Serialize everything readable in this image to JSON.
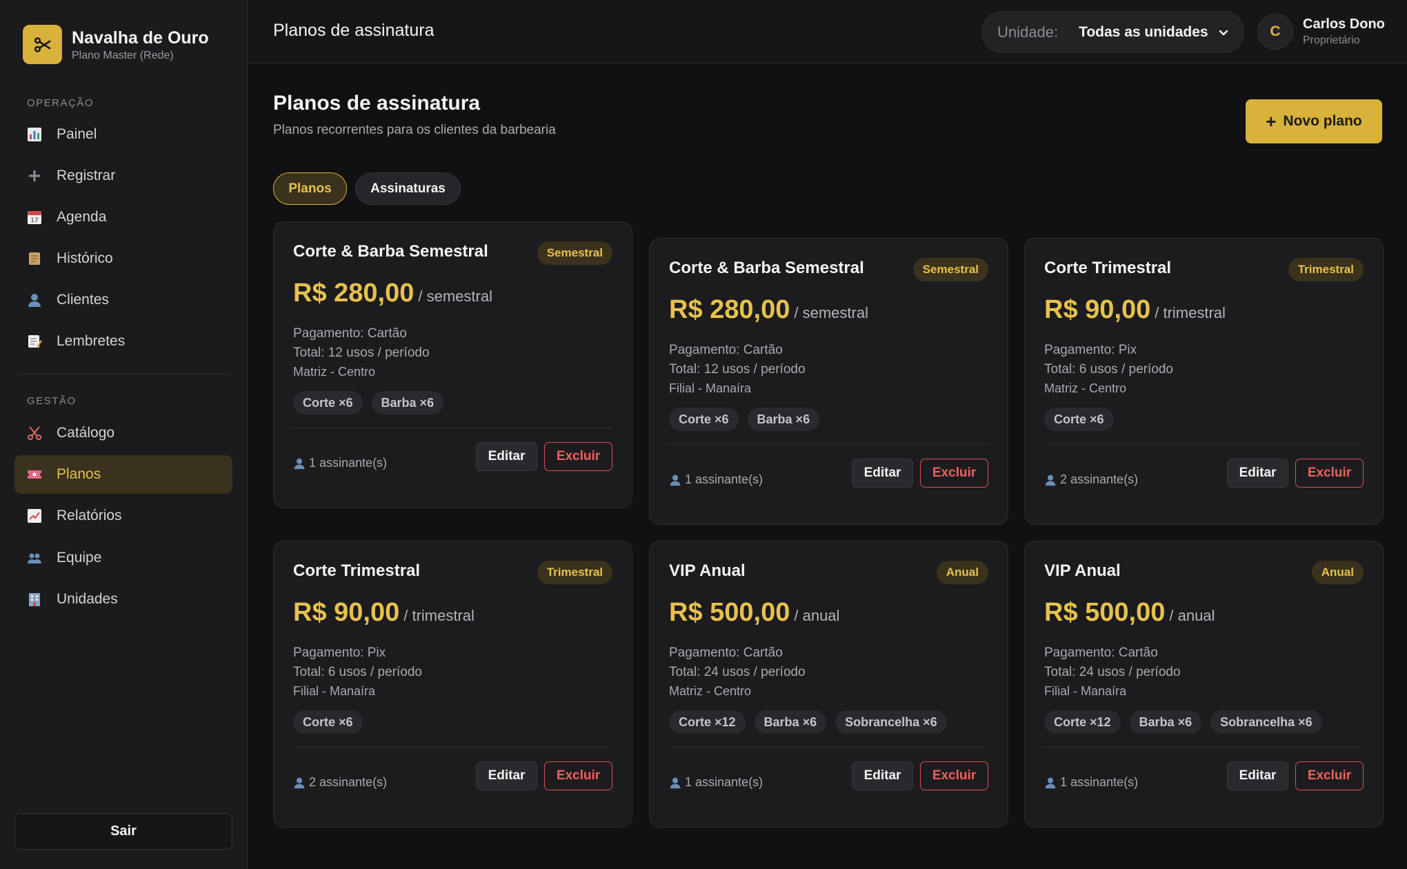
{
  "brand": {
    "name": "Navalha de Ouro",
    "plan": "Plano Master (Rede)"
  },
  "sidebar": {
    "section_operacao": "OPERAÇÃO",
    "section_gestao": "GESTÃO",
    "items": [
      {
        "label": "Painel",
        "icon": "chart-icon"
      },
      {
        "label": "Registrar",
        "icon": "plus-icon"
      },
      {
        "label": "Agenda",
        "icon": "calendar-icon"
      },
      {
        "label": "Histórico",
        "icon": "scroll-icon"
      },
      {
        "label": "Clientes",
        "icon": "user-icon"
      },
      {
        "label": "Lembretes",
        "icon": "memo-icon"
      },
      {
        "label": "Catálogo",
        "icon": "scissors-icon"
      },
      {
        "label": "Planos",
        "icon": "ticket-icon"
      },
      {
        "label": "Relatórios",
        "icon": "trend-icon"
      },
      {
        "label": "Equipe",
        "icon": "users-icon"
      },
      {
        "label": "Unidades",
        "icon": "building-icon"
      }
    ],
    "active": "Planos",
    "logout_label": "Sair"
  },
  "topbar": {
    "title": "Planos de assinatura",
    "unit_label": "Unidade:",
    "unit_value": "Todas as unidades",
    "user_initial": "C",
    "user_name": "Carlos Dono",
    "user_role": "Proprietário"
  },
  "main": {
    "title": "Planos de assinatura",
    "subtitle": "Planos recorrentes para os clientes da barbearia",
    "new_plan_label": "Novo plano",
    "tabs": [
      {
        "label": "Planos"
      },
      {
        "label": "Assinaturas"
      }
    ],
    "edit_label": "Editar",
    "delete_label": "Excluir"
  },
  "plans": [
    {
      "name": "Corte & Barba Semestral",
      "badge": "Semestral",
      "price": "R$ 280,00",
      "period": "/ semestral",
      "payment": "Pagamento: Cartão",
      "total": "Total: 12 usos / período",
      "unit": "Matriz - Centro",
      "services": [
        "Corte ×6",
        "Barba ×6"
      ],
      "subscribers": "1 assinante(s)"
    },
    {
      "name": "Corte & Barba Semestral",
      "badge": "Semestral",
      "price": "R$ 280,00",
      "period": "/ semestral",
      "payment": "Pagamento: Cartão",
      "total": "Total: 12 usos / período",
      "unit": "Filial - Manaíra",
      "services": [
        "Corte ×6",
        "Barba ×6"
      ],
      "subscribers": "1 assinante(s)"
    },
    {
      "name": "Corte Trimestral",
      "badge": "Trimestral",
      "price": "R$ 90,00",
      "period": "/ trimestral",
      "payment": "Pagamento: Pix",
      "total": "Total: 6 usos / período",
      "unit": "Matriz - Centro",
      "services": [
        "Corte ×6"
      ],
      "subscribers": "2 assinante(s)"
    },
    {
      "name": "Corte Trimestral",
      "badge": "Trimestral",
      "price": "R$ 90,00",
      "period": "/ trimestral",
      "payment": "Pagamento: Pix",
      "total": "Total: 6 usos / período",
      "unit": "Filial - Manaíra",
      "services": [
        "Corte ×6"
      ],
      "subscribers": "2 assinante(s)"
    },
    {
      "name": "VIP Anual",
      "badge": "Anual",
      "price": "R$ 500,00",
      "period": "/ anual",
      "payment": "Pagamento: Cartão",
      "total": "Total: 24 usos / período",
      "unit": "Matriz - Centro",
      "services": [
        "Corte ×12",
        "Barba ×6",
        "Sobrancelha ×6"
      ],
      "subscribers": "1 assinante(s)"
    },
    {
      "name": "VIP Anual",
      "badge": "Anual",
      "price": "R$ 500,00",
      "period": "/ anual",
      "payment": "Pagamento: Cartão",
      "total": "Total: 24 usos / período",
      "unit": "Filial - Manaíra",
      "services": [
        "Corte ×12",
        "Barba ×6",
        "Sobrancelha ×6"
      ],
      "subscribers": "1 assinante(s)"
    }
  ],
  "colors": {
    "accent": "#d9b23c",
    "accent_text": "#e7c14d",
    "danger": "#e24d4d",
    "background": "#111113"
  }
}
